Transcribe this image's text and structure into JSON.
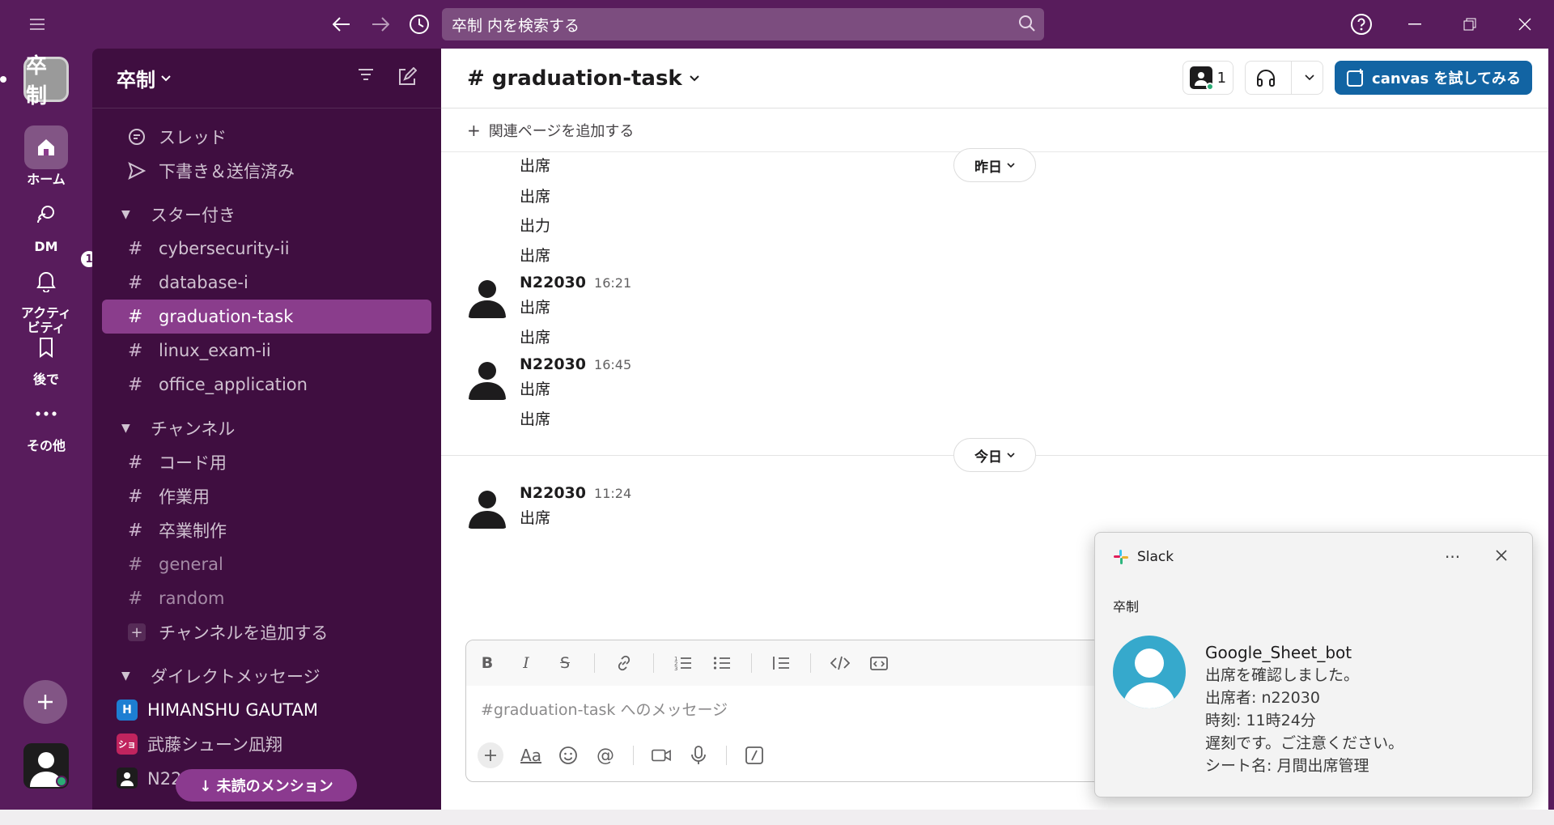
{
  "titlebar": {
    "search_placeholder": "卒制 内を検索する"
  },
  "rail": {
    "workspace_logo": "卒制",
    "items": [
      {
        "label": "ホーム",
        "icon": "home-icon",
        "active": true
      },
      {
        "label": "DM",
        "icon": "dm-icon"
      },
      {
        "label": "アクティビティ",
        "icon": "bell-icon",
        "badge": "1"
      },
      {
        "label": "後で",
        "icon": "bookmark-icon"
      },
      {
        "label": "その他",
        "icon": "more-icon"
      }
    ]
  },
  "sidebar": {
    "workspace_name": "卒制",
    "nav": [
      {
        "label": "スレッド",
        "icon": "threads-icon"
      },
      {
        "label": "下書き＆送信済み",
        "icon": "send-icon"
      }
    ],
    "starred_title": "スター付き",
    "starred": [
      {
        "label": "cybersecurity-ii"
      },
      {
        "label": "database-i"
      },
      {
        "label": "graduation-task",
        "active": true
      },
      {
        "label": "linux_exam-ii"
      },
      {
        "label": "office_application"
      }
    ],
    "channels_title": "チャンネル",
    "channels": [
      {
        "label": "コード用"
      },
      {
        "label": "作業用"
      },
      {
        "label": "卒業制作"
      },
      {
        "label": "general",
        "dim": true
      },
      {
        "label": "random",
        "dim": true
      }
    ],
    "add_channel": "チャンネルを追加する",
    "dm_title": "ダイレクトメッセージ",
    "dms": [
      {
        "label": "HIMANSHU GAUTAM",
        "initial": "H",
        "color": "#1d7ed2"
      },
      {
        "label": "武藤シューン凪翔",
        "initial": "ショ",
        "color": "#c0245e"
      },
      {
        "label": "N22030（自分）",
        "initial": "",
        "color": "#1d1c1d"
      }
    ],
    "unread_pill": "↓ 未読のメンション"
  },
  "channel": {
    "name": "# graduation-task",
    "member_count": "1",
    "canvas_button": "canvas を試してみる",
    "add_bookmark": "関連ページを追加する"
  },
  "messages": {
    "early_lines": [
      "出席",
      "出席",
      "出力",
      "出席"
    ],
    "day_yesterday": "昨日",
    "day_today": "今日",
    "groups": [
      {
        "author": "N22030",
        "time": "16:21",
        "lines": [
          "出席",
          "出席"
        ]
      },
      {
        "author": "N22030",
        "time": "16:45",
        "lines": [
          "出席",
          "出席"
        ]
      },
      {
        "author": "N22030",
        "time": "11:24",
        "lines": [
          "出席"
        ]
      }
    ]
  },
  "composer": {
    "placeholder": "#graduation-task へのメッセージ"
  },
  "toast": {
    "app": "Slack",
    "workspace": "卒制",
    "sender": "Google_Sheet_bot",
    "lines": [
      "出席を確認しました。",
      "出席者: n22030",
      "時刻: 11時24分",
      "遅刻です。ご注意ください。",
      "シート名: 月間出席管理"
    ]
  },
  "colors": {
    "aubergine": "#581c5c",
    "sidebar": "#3f0e40",
    "active_channel": "#8a3d8c",
    "canvas_button": "#1264a3",
    "online": "#2bac76"
  }
}
